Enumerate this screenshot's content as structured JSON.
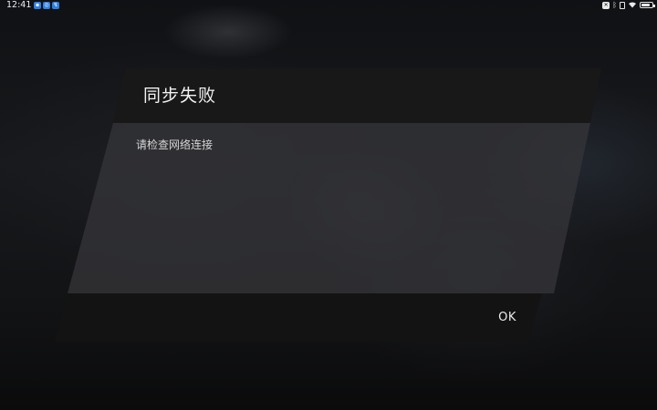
{
  "status_bar": {
    "time": "12:41",
    "notification_icons": [
      "app-notification-icon",
      "app-notification-icon",
      "app-notification-icon"
    ],
    "system_icons": [
      "do-not-disturb-icon",
      "bluetooth-icon",
      "vibrate-icon",
      "wifi-icon",
      "battery-icon"
    ],
    "battery_level": 0.8
  },
  "dialog": {
    "title": "同步失败",
    "message": "请检查网络连接",
    "ok_label": "OK"
  }
}
